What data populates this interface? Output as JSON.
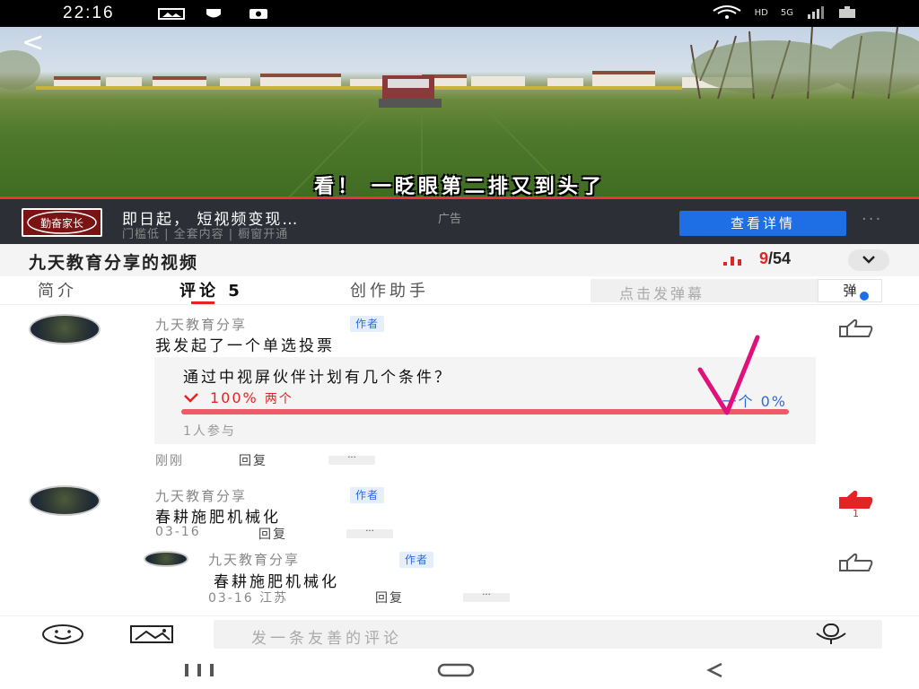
{
  "status_bar": {
    "time": "22:16",
    "network": "HD",
    "signal_label": "5G"
  },
  "video": {
    "subtitle": "看！ 一眨眼第二排又到头了",
    "back_glyph": "<"
  },
  "ad": {
    "logo_text": "勤奋家长",
    "title": "即日起， 短视频变现…",
    "tag": "广告",
    "subtitle": "门槛低 | 全套内容 | 橱窗开通",
    "button": "查看详情",
    "more": "···"
  },
  "header": {
    "video_title": "九天教育分享的视频",
    "episode_current": "9",
    "episode_total": "/54",
    "chevron": "⌄"
  },
  "tabs": {
    "intro": "简介",
    "comments": "评论",
    "comments_count": "5",
    "creator": "创作助手",
    "danmu_placeholder": "点击发弹幕",
    "danmu_button": "弹"
  },
  "comments": [
    {
      "user": "九天教育分享",
      "badge": "作者",
      "text": "我发起了一个单选投票",
      "poll": {
        "question": "通过中视屏伙伴计划有几个条件？",
        "option1_pct": "100%",
        "option1_label": "两个",
        "option2": "一个 0%",
        "fill_fraction": 1.0,
        "participants": "1人参与"
      },
      "time": "刚刚",
      "reply": "回复",
      "more": "···"
    },
    {
      "user": "九天教育分享",
      "badge": "作者",
      "text": "春耕施肥机械化",
      "time": "03-16",
      "reply": "回复",
      "more": "···",
      "likes": "1",
      "liked": true
    }
  ],
  "reply": {
    "user": "九天教育分享",
    "badge": "作者",
    "text": "春耕施肥机械化",
    "time": "03-16 江苏",
    "reply": "回复",
    "more": "···"
  },
  "composer": {
    "placeholder": "发一条友善的评论"
  },
  "colors": {
    "accent_red": "#e32424",
    "brand_blue": "#1e6ee6",
    "poll_fill": "#ef5a6a",
    "annotation_pink": "#e0117a"
  }
}
